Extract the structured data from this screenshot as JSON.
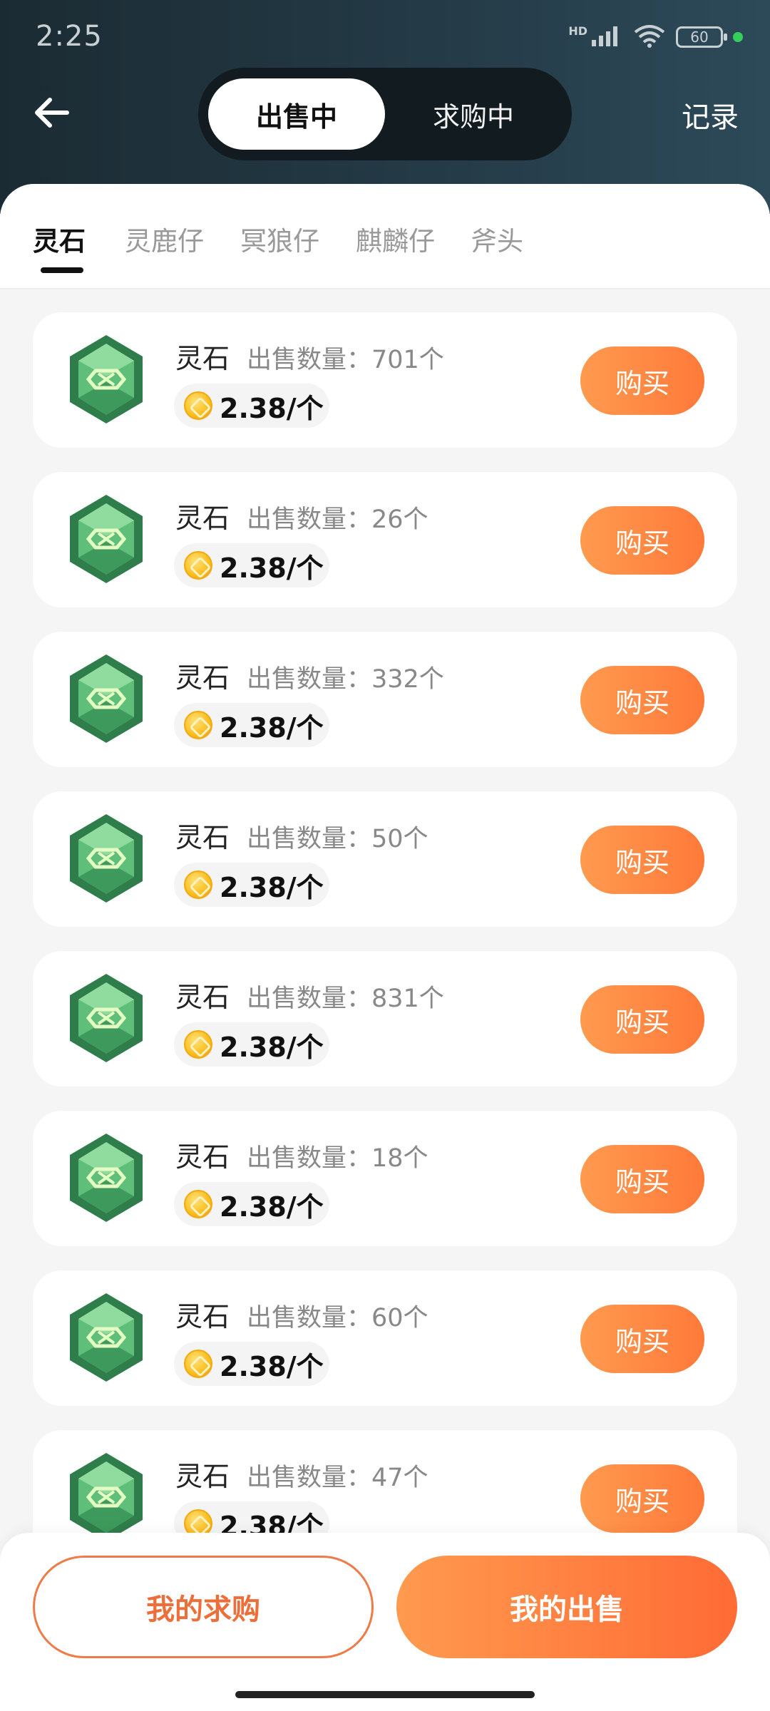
{
  "status_bar": {
    "time": "2:25",
    "network_label": "HD",
    "battery": "60",
    "icons": [
      "signal-icon",
      "wifi-icon",
      "battery-icon",
      "active-dot"
    ]
  },
  "header": {
    "back_icon": "arrow-left-icon",
    "tabs": [
      {
        "label": "出售中",
        "active": true
      },
      {
        "label": "求购中",
        "active": false
      }
    ],
    "records_label": "记录"
  },
  "categories": [
    {
      "label": "灵石",
      "active": true
    },
    {
      "label": "灵鹿仔",
      "active": false
    },
    {
      "label": "冥狼仔",
      "active": false
    },
    {
      "label": "麒麟仔",
      "active": false
    },
    {
      "label": "斧头",
      "active": false
    }
  ],
  "listings": [
    {
      "name": "灵石",
      "quantity_label": "出售数量：701个",
      "price": "2.38/个",
      "button": "购买"
    },
    {
      "name": "灵石",
      "quantity_label": "出售数量：26个",
      "price": "2.38/个",
      "button": "购买"
    },
    {
      "name": "灵石",
      "quantity_label": "出售数量：332个",
      "price": "2.38/个",
      "button": "购买"
    },
    {
      "name": "灵石",
      "quantity_label": "出售数量：50个",
      "price": "2.38/个",
      "button": "购买"
    },
    {
      "name": "灵石",
      "quantity_label": "出售数量：831个",
      "price": "2.38/个",
      "button": "购买"
    },
    {
      "name": "灵石",
      "quantity_label": "出售数量：18个",
      "price": "2.38/个",
      "button": "购买"
    },
    {
      "name": "灵石",
      "quantity_label": "出售数量：60个",
      "price": "2.38/个",
      "button": "购买"
    },
    {
      "name": "灵石",
      "quantity_label": "出售数量：47个",
      "price": "2.38/个",
      "button": "购买"
    }
  ],
  "bottom_bar": {
    "my_buy_label": "我的求购",
    "my_sell_label": "我的出售"
  },
  "colors": {
    "accent_orange": "#ff7a3a",
    "header_dark": "#1b2b33",
    "gem_green": "#3f9a5a"
  }
}
